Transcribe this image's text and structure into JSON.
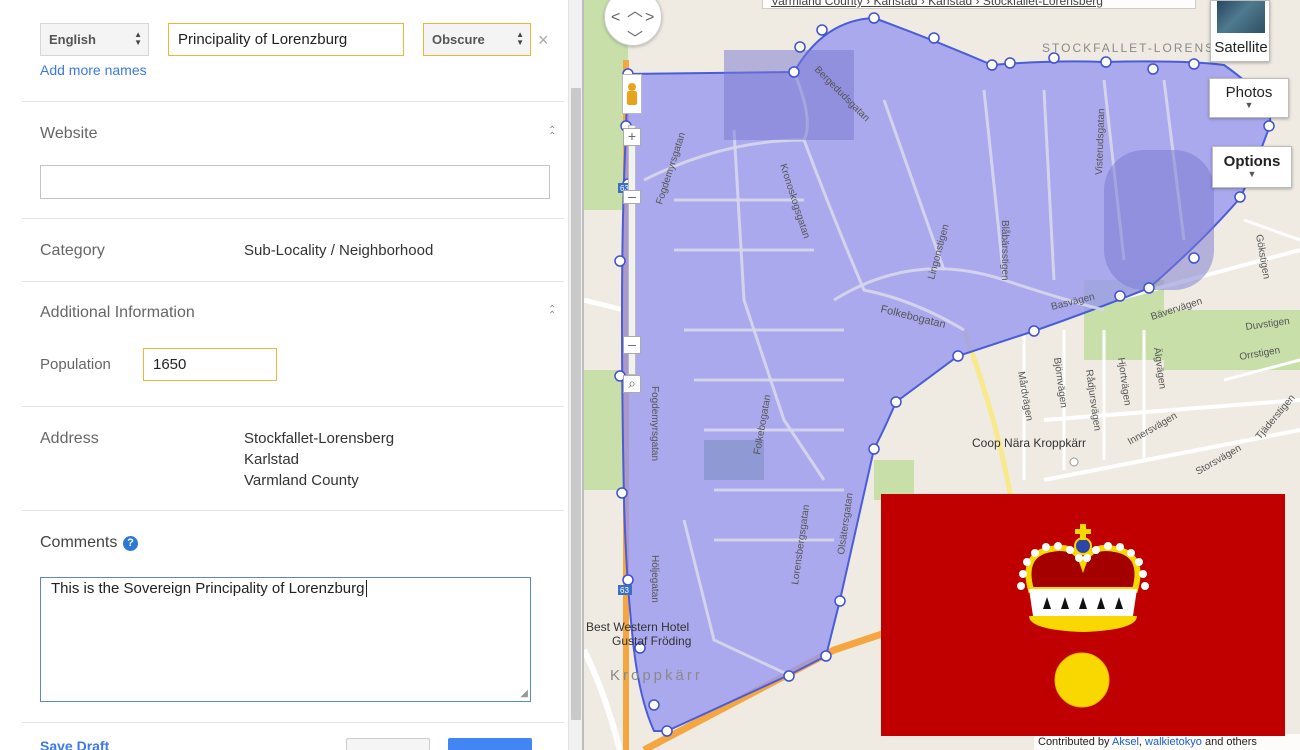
{
  "names": {
    "language": "English",
    "name_value": "Principality of Lorenzburg",
    "visibility": "Obscure",
    "add_more_label": "Add more names"
  },
  "website": {
    "label": "Website",
    "value": ""
  },
  "category": {
    "label": "Category",
    "value": "Sub-Locality / Neighborhood"
  },
  "additional": {
    "label": "Additional Information",
    "population_label": "Population",
    "population_value": "1650"
  },
  "address": {
    "label": "Address",
    "lines": [
      "Stockfallet-Lorensberg",
      "Karlstad",
      "Varmland County"
    ]
  },
  "comments": {
    "label": "Comments",
    "help_icon": "?",
    "value": "This is the Sovereign Principality of Lorenzburg"
  },
  "footer": {
    "draft_link": "Save Draft"
  },
  "map": {
    "breadcrumb": "Varmland County › Karlstad › Karlstad › Stockfallet-Lorensberg",
    "buttons": {
      "satellite": "Satellite",
      "photos": "Photos",
      "options": "Options"
    },
    "labels": {
      "area": "STOCKFALLET-LORENS",
      "kroppkarr": "Kroppkärr",
      "coop": "Coop Nära Kroppkärr",
      "hotel_line1": "Best Western Hotel",
      "hotel_line2": "Gustaf Fröding",
      "e63": "63"
    },
    "streets": {
      "fogdemyrsgatan": "Fogdemyrsgatan",
      "kronoskogsgatan": "Kronoskogsgatan",
      "bergedudsgatan": "Bergedudsgatan",
      "folkebogatan": "Folkebogatan",
      "lingonstigen": "Lingonstigen",
      "blabarsstigen": "Blåbärsstigen",
      "visterudsgatan": "Visterudsgatan",
      "basvagen": "Basvägen",
      "gokstigen": "Gökstigen",
      "bavervagen": "Bävervägen",
      "duvstigen": "Duvstigen",
      "orrstigen": "Orrstigen",
      "tjaderstigen": "Tjäderstigen",
      "mardvagen": "Mårdvägen",
      "bjornvagen": "Björnvägen",
      "radjursvagen": "Rådjursvägen",
      "hjortvagen": "Hjortvägen",
      "algvagen": "Älgvägen",
      "innersvagen": "Innersvägen",
      "storsvagen": "Storsvägen",
      "lorensbergsgatan": "Lorensbergsgatan",
      "olsatersgatan": "Olsätersgatan",
      "holjegatan": "Höljegatan",
      "folkebogatan_south": "Folkebogatan"
    },
    "attribution": {
      "prefix": "Contributed by",
      "user1": "Aksel",
      "user2": "walkietokyo",
      "suffix": "and others"
    }
  },
  "flag": {
    "background_color": "#c00000",
    "crown_color": "#f8d800",
    "crown_cap_color": "#a80000",
    "orb_color": "#f8d800"
  }
}
